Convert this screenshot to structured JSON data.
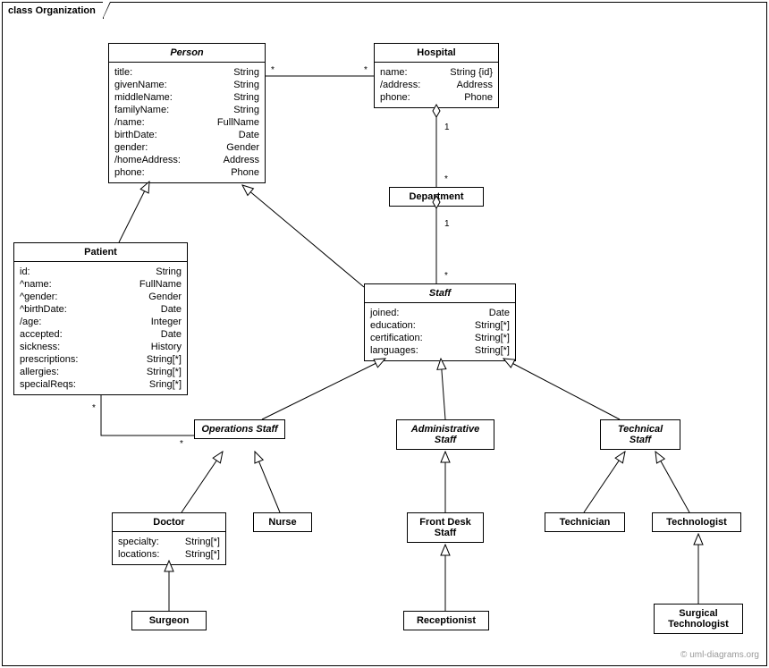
{
  "frame": {
    "title": "class Organization"
  },
  "watermark": "© uml-diagrams.org",
  "classes": {
    "person": {
      "name": "Person",
      "attrs": [
        [
          "title:",
          "String"
        ],
        [
          "givenName:",
          "String"
        ],
        [
          "middleName:",
          "String"
        ],
        [
          "familyName:",
          "String"
        ],
        [
          "/name:",
          "FullName"
        ],
        [
          "birthDate:",
          "Date"
        ],
        [
          "gender:",
          "Gender"
        ],
        [
          "/homeAddress:",
          "Address"
        ],
        [
          "phone:",
          "Phone"
        ]
      ]
    },
    "hospital": {
      "name": "Hospital",
      "attrs": [
        [
          "name:",
          "String {id}"
        ],
        [
          "/address:",
          "Address"
        ],
        [
          "phone:",
          "Phone"
        ]
      ]
    },
    "department": {
      "name": "Department"
    },
    "patient": {
      "name": "Patient",
      "attrs": [
        [
          "id:",
          "String"
        ],
        [
          "^name:",
          "FullName"
        ],
        [
          "^gender:",
          "Gender"
        ],
        [
          "^birthDate:",
          "Date"
        ],
        [
          "/age:",
          "Integer"
        ],
        [
          "accepted:",
          "Date"
        ],
        [
          "sickness:",
          "History"
        ],
        [
          "prescriptions:",
          "String[*]"
        ],
        [
          "allergies:",
          "String[*]"
        ],
        [
          "specialReqs:",
          "Sring[*]"
        ]
      ]
    },
    "staff": {
      "name": "Staff",
      "attrs": [
        [
          "joined:",
          "Date"
        ],
        [
          "education:",
          "String[*]"
        ],
        [
          "certification:",
          "String[*]"
        ],
        [
          "languages:",
          "String[*]"
        ]
      ]
    },
    "opsStaff": {
      "name": "Operations Staff"
    },
    "adminStaff": {
      "name": "Administrative Staff"
    },
    "techStaff": {
      "name": "Technical Staff"
    },
    "doctor": {
      "name": "Doctor",
      "attrs": [
        [
          "specialty:",
          "String[*]"
        ],
        [
          "locations:",
          "String[*]"
        ]
      ]
    },
    "nurse": {
      "name": "Nurse"
    },
    "frontDesk": {
      "name": "Front Desk Staff"
    },
    "technician": {
      "name": "Technician"
    },
    "technologist": {
      "name": "Technologist"
    },
    "surgeon": {
      "name": "Surgeon"
    },
    "receptionist": {
      "name": "Receptionist"
    },
    "surgTech": {
      "name": "Surgical Technologist"
    }
  },
  "mult": {
    "person_hosp_left": "*",
    "person_hosp_right": "*",
    "hosp_dept_top": "1",
    "hosp_dept_bot": "*",
    "dept_staff_top": "1",
    "dept_staff_bot": "*",
    "patient_ops_left": "*",
    "patient_ops_right": "*"
  }
}
